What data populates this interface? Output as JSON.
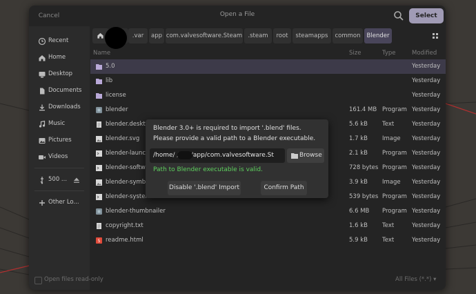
{
  "header": {
    "cancel_label": "Cancel",
    "title": "Open a File",
    "select_label": "Select"
  },
  "sidebar": {
    "items": [
      {
        "label": "Recent",
        "icon": "clock-icon"
      },
      {
        "label": "Home",
        "icon": "home-icon"
      },
      {
        "label": "Desktop",
        "icon": "desktop-icon"
      },
      {
        "label": "Documents",
        "icon": "document-icon"
      },
      {
        "label": "Downloads",
        "icon": "download-icon"
      },
      {
        "label": "Music",
        "icon": "music-icon"
      },
      {
        "label": "Pictures",
        "icon": "image-icon"
      },
      {
        "label": "Videos",
        "icon": "video-icon"
      }
    ],
    "drive": {
      "label": "500 ...",
      "icon": "usb-icon",
      "eject_icon": "eject-icon"
    },
    "other": {
      "label": "Other Lo...",
      "icon": "plus-icon"
    },
    "readonly_label": "Open files read-only"
  },
  "breadcrumbs": [
    ".var",
    "app",
    "com.valvesoftware.Steam",
    ".steam",
    "root",
    "steamapps",
    "common",
    "Blender"
  ],
  "columns": {
    "name": "Name",
    "size": "Size",
    "type": "Type",
    "modified": "Modified"
  },
  "files": [
    {
      "name": "5.0",
      "size": "",
      "type": "",
      "modified": "Yesterday",
      "icon": "folder-icon",
      "selected": true
    },
    {
      "name": "lib",
      "size": "",
      "type": "",
      "modified": "Yesterday",
      "icon": "folder-icon"
    },
    {
      "name": "license",
      "size": "",
      "type": "",
      "modified": "Yesterday",
      "icon": "folder-icon"
    },
    {
      "name": "blender",
      "size": "161.4 MB",
      "type": "Program",
      "modified": "Yesterday",
      "icon": "program-icon"
    },
    {
      "name": "blender.deskto",
      "size": "5.6 kB",
      "type": "Text",
      "modified": "Yesterday",
      "icon": "text-file-icon"
    },
    {
      "name": "blender.svg",
      "size": "1.7 kB",
      "type": "Image",
      "modified": "Yesterday",
      "icon": "image-file-icon"
    },
    {
      "name": "blender-launch",
      "size": "2.1 kB",
      "type": "Program",
      "modified": "Yesterday",
      "icon": "script-icon"
    },
    {
      "name": "blender-softwa",
      "size": "728 bytes",
      "type": "Program",
      "modified": "Yesterday",
      "icon": "script-icon"
    },
    {
      "name": "blender-symbo",
      "size": "3.9 kB",
      "type": "Image",
      "modified": "Yesterday",
      "icon": "image-file-icon"
    },
    {
      "name": "blender-system",
      "size": "539 bytes",
      "type": "Program",
      "modified": "Yesterday",
      "icon": "script-icon"
    },
    {
      "name": "blender-thumbnailer",
      "size": "6.6 MB",
      "type": "Program",
      "modified": "Yesterday",
      "icon": "program-icon"
    },
    {
      "name": "copyright.txt",
      "size": "1.6 kB",
      "type": "Text",
      "modified": "Yesterday",
      "icon": "text-file-icon"
    },
    {
      "name": "readme.html",
      "size": "5.9 kB",
      "type": "Text",
      "modified": "Yesterday",
      "icon": "html-file-icon"
    }
  ],
  "filter_label": "All Files (*.*) ▾",
  "popup": {
    "line1": "Blender 3.0+ is required to import '.blend' files.",
    "line2": "Please provide a valid path to a Blender executable.",
    "path_value": "/home/       /.var/app/com.valvesoftware.St",
    "browse_label": "Browse",
    "valid_message": "Path to Blender executable is valid.",
    "disable_label": "Disable '.blend' Import",
    "confirm_label": "Confirm Path"
  },
  "colors": {
    "accent": "#a09bb5",
    "selected_row": "#3d3a49",
    "valid_text": "#5ed05e",
    "folder": "#b9a9d8",
    "html_icon": "#e04a3a"
  }
}
